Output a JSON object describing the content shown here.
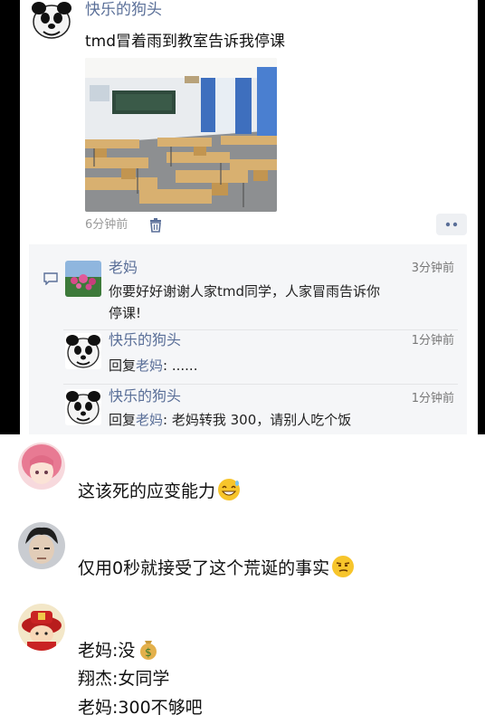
{
  "post": {
    "author": "快乐的狗头",
    "text": "tmd冒着雨到教室告诉我停课",
    "time": "6分钟前"
  },
  "comments": [
    {
      "author": "老妈",
      "time": "3分钟前",
      "text_line1": "你要好好谢谢人家tmd同学，人家冒雨告诉你",
      "text_line2": "停课!"
    },
    {
      "author": "快乐的狗头",
      "time": "1分钟前",
      "reply_prefix": "回复",
      "reply_to": "老妈",
      "reply_text": ": ......"
    },
    {
      "author": "快乐的狗头",
      "time": "1分钟前",
      "reply_prefix": "回复",
      "reply_to": "老妈",
      "reply_text": ": 老妈转我 300，请别人吃个饭"
    }
  ],
  "replies": [
    {
      "text": "这该死的应变能力",
      "emoji": "grinning-sweat-emoji"
    },
    {
      "text": "仅用0秒就接受了这个荒诞的事实",
      "emoji": "smirk-emoji"
    },
    {
      "line1": "老妈:没",
      "emoji": "money-bag-emoji",
      "line2": "翔杰:女同学",
      "line3": "老妈:300不够吧"
    }
  ],
  "colors": {
    "name_blue": "#5a6f98",
    "panel_gray": "#f5f6f8",
    "frame_black": "#000000"
  }
}
